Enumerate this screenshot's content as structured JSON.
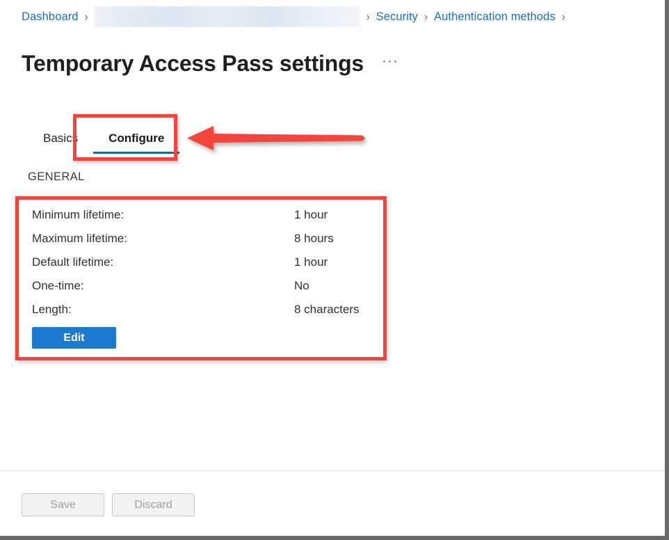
{
  "breadcrumb": {
    "items": [
      {
        "label": "Dashboard",
        "type": "link"
      },
      {
        "label": "",
        "type": "redacted"
      },
      {
        "label": "Security",
        "type": "link"
      },
      {
        "label": "Authentication methods",
        "type": "link"
      }
    ],
    "separator": "›"
  },
  "header": {
    "title": "Temporary Access Pass settings",
    "more_menu": "···"
  },
  "tabs": [
    {
      "label": "Basics",
      "selected": false
    },
    {
      "label": "Configure",
      "selected": true
    }
  ],
  "section": {
    "heading": "GENERAL",
    "rows": [
      {
        "label": "Minimum lifetime:",
        "value": "1 hour"
      },
      {
        "label": "Maximum lifetime:",
        "value": "8 hours"
      },
      {
        "label": "Default lifetime:",
        "value": "1 hour"
      },
      {
        "label": "One-time:",
        "value": "No"
      },
      {
        "label": "Length:",
        "value": "8 characters"
      }
    ],
    "edit_label": "Edit"
  },
  "footer": {
    "save_label": "Save",
    "discard_label": "Discard"
  },
  "annotations": {
    "highlight_color": "#f4443c",
    "arrow_color": "#f4443c",
    "accent_color": "#0f6cbd",
    "edit_button_color": "#1b79d0",
    "link_color": "#1a6fc4"
  }
}
